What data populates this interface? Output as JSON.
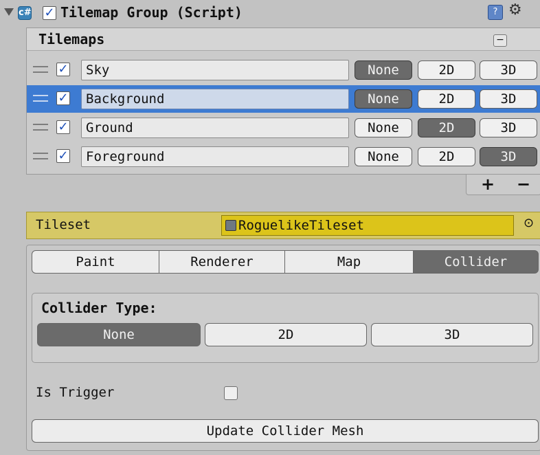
{
  "header": {
    "title": "Tilemap Group (Script)",
    "enabled": true
  },
  "tilemaps": {
    "title": "Tilemaps",
    "options": [
      "None",
      "2D",
      "3D"
    ],
    "rows": [
      {
        "name": "Sky",
        "enabled": true,
        "selected_option": "None",
        "selected": false
      },
      {
        "name": "Background",
        "enabled": true,
        "selected_option": "None",
        "selected": true
      },
      {
        "name": "Ground",
        "enabled": true,
        "selected_option": "2D",
        "selected": false
      },
      {
        "name": "Foreground",
        "enabled": true,
        "selected_option": "3D",
        "selected": false
      }
    ],
    "add_label": "+",
    "remove_label": "−"
  },
  "tileset": {
    "label": "Tileset",
    "value": "RoguelikeTileset"
  },
  "tabs": {
    "items": [
      "Paint",
      "Renderer",
      "Map",
      "Collider"
    ],
    "active": "Collider"
  },
  "collider": {
    "type_label": "Collider Type:",
    "type_options": [
      "None",
      "2D",
      "3D"
    ],
    "type_selected": "None",
    "trigger_label": "Is Trigger",
    "is_trigger": false,
    "update_button": "Update Collider Mesh"
  },
  "colors": {
    "selection": "#3d7bd2",
    "tileset_highlight": "#dcc41a",
    "active_button": "#6b6b6b"
  }
}
